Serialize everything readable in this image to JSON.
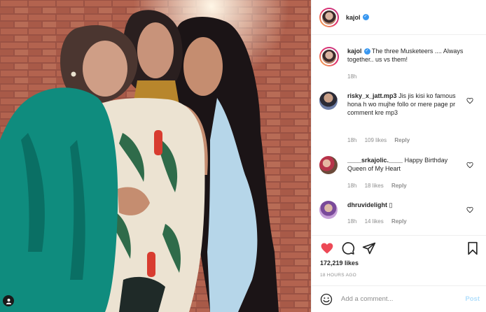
{
  "post": {
    "username": "kajol",
    "verified_glyph": "✓",
    "caption": "The three Musketeers .... Always together.. us vs them!",
    "caption_time": "18h",
    "likes": "172,219 likes",
    "time_ago": "18 HOURS AGO",
    "add_comment_placeholder": "Add a comment...",
    "post_label": "Post",
    "accent_color": "#3897f0",
    "liked_color": "#ed4956"
  },
  "comments": [
    {
      "username": "risky_x_jatt.mp3",
      "text": "Jis jis kisi ko famous hona h wo mujhe follo or mere page pr comment kre mp3",
      "time": "18h",
      "likes": "109 likes",
      "reply": "Reply"
    },
    {
      "username": "____srkajolic.____",
      "text": "Happy Birthday Queen of My Heart",
      "time": "18h",
      "likes": "18 likes",
      "reply": "Reply"
    },
    {
      "username": "dhruvidelight",
      "text": "▯",
      "time": "18h",
      "likes": "14 likes",
      "reply": "Reply"
    }
  ],
  "icons": {
    "like": "heart-icon",
    "comment": "comment-icon",
    "share": "paper-plane-icon",
    "save": "bookmark-icon",
    "emoji": "smiley-icon",
    "tag": "user-tag-icon"
  }
}
